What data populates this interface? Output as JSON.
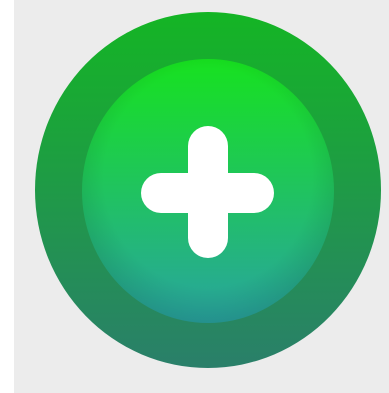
{
  "app": {
    "icon": "plus-icon",
    "colors": {
      "background": "#ececec",
      "outer_top": "#14b524",
      "outer_bottom": "#2a7f6a",
      "inner_top": "#17e21f",
      "inner_bottom": "#29a4a0",
      "glyph": "#ffffff"
    }
  }
}
